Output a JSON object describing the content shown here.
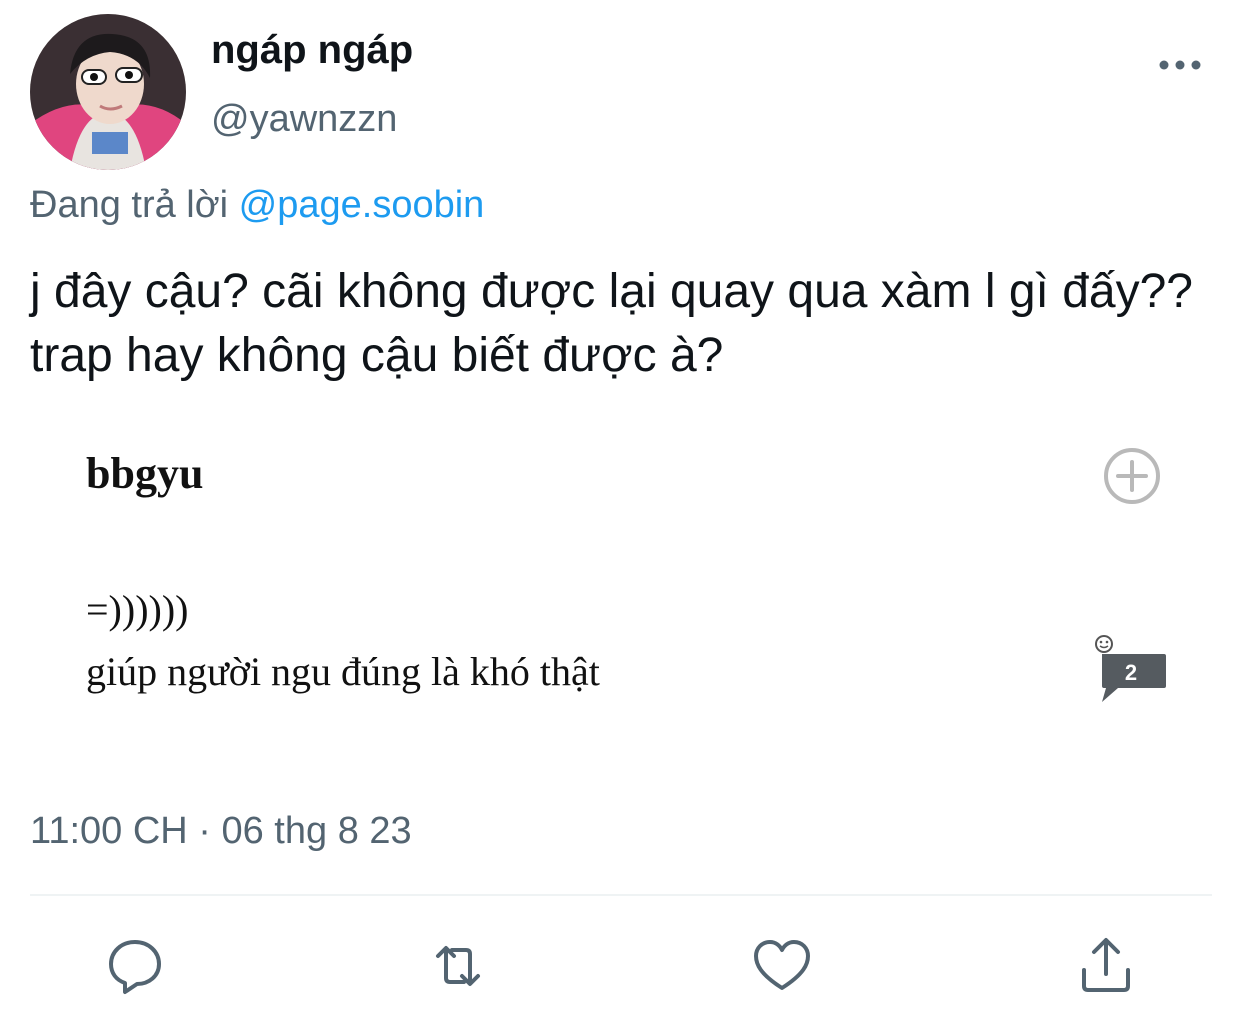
{
  "author": {
    "display_name": "ngáp ngáp",
    "handle": "@yawnzzn"
  },
  "reply_context": {
    "prefix": "Đang trả lời",
    "mention": "@page.soobin"
  },
  "tweet": {
    "text": "j đây cậu? cãi không được lại quay qua xàm l gì đấy?? trap hay không cậu biết được à?",
    "timestamp": "11:00 CH · 06 thg 8 23"
  },
  "embedded_post": {
    "username": "bbgyu",
    "line1": "=))))))",
    "line2": "giúp người ngu đúng là khó thật",
    "comment_count": "2"
  },
  "icons": {
    "more": "more-dots-icon",
    "plus": "plus-circle-icon",
    "comment_bubble": "comment-bubble-icon",
    "reply": "reply-icon",
    "retweet": "retweet-icon",
    "like": "heart-icon",
    "share": "share-icon"
  },
  "colors": {
    "text": "#0f1419",
    "secondary": "#536471",
    "link": "#1d9bf0",
    "divider": "#eff3f4"
  }
}
